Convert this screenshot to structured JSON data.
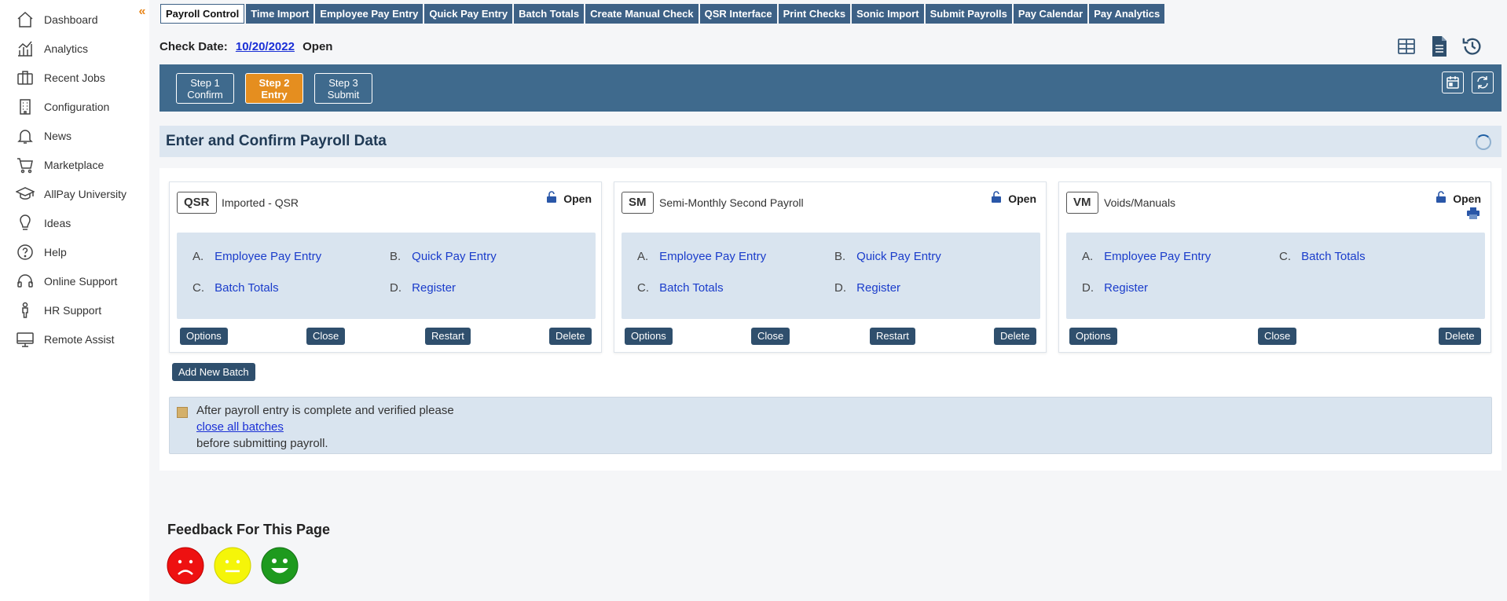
{
  "sidebar": {
    "items": [
      {
        "label": "Dashboard",
        "icon": "home-icon"
      },
      {
        "label": "Analytics",
        "icon": "analytics-icon"
      },
      {
        "label": "Recent Jobs",
        "icon": "briefcase-icon"
      },
      {
        "label": "Configuration",
        "icon": "building-icon"
      },
      {
        "label": "News",
        "icon": "bell-icon"
      },
      {
        "label": "Marketplace",
        "icon": "shopping-cart-icon"
      },
      {
        "label": "AllPay University",
        "icon": "graduation-cap-icon"
      },
      {
        "label": "Ideas",
        "icon": "lightbulb-icon"
      },
      {
        "label": "Help",
        "icon": "question-icon"
      },
      {
        "label": "Online Support",
        "icon": "headset-icon"
      },
      {
        "label": "HR Support",
        "icon": "person-icon"
      },
      {
        "label": "Remote Assist",
        "icon": "monitor-icon"
      }
    ]
  },
  "tabs": [
    "Payroll Control",
    "Time Import",
    "Employee Pay Entry",
    "Quick Pay Entry",
    "Batch Totals",
    "Create Manual Check",
    "QSR Interface",
    "Print Checks",
    "Sonic Import",
    "Submit Payrolls",
    "Pay Calendar",
    "Pay Analytics"
  ],
  "check": {
    "label": "Check Date:",
    "date": "10/20/2022",
    "status": "Open"
  },
  "steps": [
    {
      "line1": "Step 1",
      "line2": "Confirm"
    },
    {
      "line1": "Step 2",
      "line2": "Entry"
    },
    {
      "line1": "Step 3",
      "line2": "Submit"
    }
  ],
  "main": {
    "title": "Enter and Confirm Payroll Data"
  },
  "cards": [
    {
      "code": "QSR",
      "title": "Imported - QSR",
      "status": "Open",
      "links": [
        {
          "letter": "A.",
          "label": "Employee Pay Entry"
        },
        {
          "letter": "B.",
          "label": "Quick Pay Entry"
        },
        {
          "letter": "C.",
          "label": "Batch Totals"
        },
        {
          "letter": "D.",
          "label": "Register"
        }
      ],
      "buttons": [
        "Options",
        "Close",
        "Restart",
        "Delete"
      ]
    },
    {
      "code": "SM",
      "title": "Semi-Monthly Second Payroll",
      "status": "Open",
      "links": [
        {
          "letter": "A.",
          "label": "Employee Pay Entry"
        },
        {
          "letter": "B.",
          "label": "Quick Pay Entry"
        },
        {
          "letter": "C.",
          "label": "Batch Totals"
        },
        {
          "letter": "D.",
          "label": "Register"
        }
      ],
      "buttons": [
        "Options",
        "Close",
        "Restart",
        "Delete"
      ]
    },
    {
      "code": "VM",
      "title": "Voids/Manuals",
      "status": "Open",
      "links": [
        {
          "letter": "A.",
          "label": "Employee Pay Entry"
        },
        {
          "letter": "C.",
          "label": "Batch Totals"
        },
        {
          "letter": "D.",
          "label": "Register"
        }
      ],
      "buttons": [
        "Options",
        "Close",
        "Delete"
      ]
    }
  ],
  "add_batch": "Add New Batch",
  "note": {
    "line1": "After payroll entry is complete and verified please",
    "link": "close all batches",
    "line3": "before submitting payroll."
  },
  "feedback": {
    "title": "Feedback For This Page"
  },
  "colors": {
    "accent": "#e58e1f",
    "nav_bar": "#3f6a8d",
    "tab_bg": "#3d6186",
    "link": "#1a3ccb",
    "sad": "#ee1111",
    "neutral": "#f5f509",
    "happy": "#1e9a1e"
  }
}
